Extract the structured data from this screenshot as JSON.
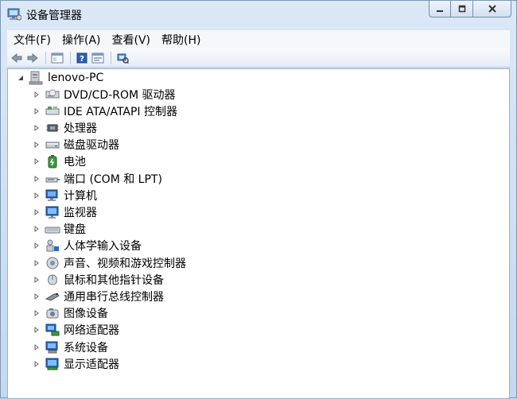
{
  "window": {
    "title": "设备管理器"
  },
  "menu": [
    "文件(F)",
    "操作(A)",
    "查看(V)",
    "帮助(H)"
  ],
  "toolbar": {
    "icons": [
      "back-arrow-icon",
      "forward-arrow-icon",
      "show-hide-console-tree-icon",
      "help-icon",
      "properties-icon",
      "scan-hardware-icon"
    ]
  },
  "tree": {
    "root": "lenovo-PC",
    "items": [
      {
        "label": "DVD/CD-ROM 驱动器",
        "icon": "dvd-drive-icon"
      },
      {
        "label": "IDE ATA/ATAPI 控制器",
        "icon": "ide-controller-icon"
      },
      {
        "label": "处理器",
        "icon": "processor-icon"
      },
      {
        "label": "磁盘驱动器",
        "icon": "disk-drive-icon"
      },
      {
        "label": "电池",
        "icon": "battery-icon"
      },
      {
        "label": "端口 (COM 和 LPT)",
        "icon": "port-icon"
      },
      {
        "label": "计算机",
        "icon": "computer-icon"
      },
      {
        "label": "监视器",
        "icon": "monitor-icon"
      },
      {
        "label": "键盘",
        "icon": "keyboard-icon"
      },
      {
        "label": "人体学输入设备",
        "icon": "hid-icon"
      },
      {
        "label": "声音、视频和游戏控制器",
        "icon": "sound-icon"
      },
      {
        "label": "鼠标和其他指针设备",
        "icon": "mouse-icon"
      },
      {
        "label": "通用串行总线控制器",
        "icon": "usb-icon"
      },
      {
        "label": "图像设备",
        "icon": "imaging-device-icon"
      },
      {
        "label": "网络适配器",
        "icon": "network-adapter-icon"
      },
      {
        "label": "系统设备",
        "icon": "system-device-icon"
      },
      {
        "label": "显示适配器",
        "icon": "display-adapter-icon"
      }
    ]
  }
}
